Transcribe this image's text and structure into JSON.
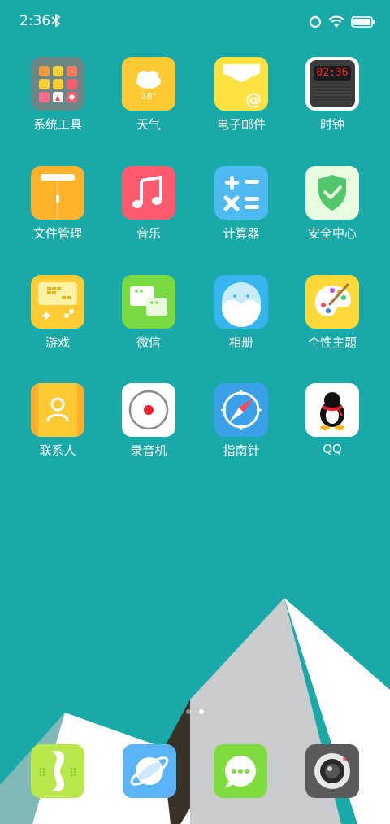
{
  "status": {
    "time": "2:36"
  },
  "apps": [
    {
      "label": "系统工具",
      "icon": "folder-icon"
    },
    {
      "label": "天气",
      "icon": "weather-icon",
      "temp": "28°"
    },
    {
      "label": "电子邮件",
      "icon": "email-icon",
      "glyph": "@"
    },
    {
      "label": "时钟",
      "icon": "clock-icon",
      "clock_text": "02:36"
    },
    {
      "label": "文件管理",
      "icon": "file-manager-icon"
    },
    {
      "label": "音乐",
      "icon": "music-icon"
    },
    {
      "label": "计算器",
      "icon": "calculator-icon"
    },
    {
      "label": "安全中心",
      "icon": "security-icon"
    },
    {
      "label": "游戏",
      "icon": "game-icon"
    },
    {
      "label": "微信",
      "icon": "wechat-icon"
    },
    {
      "label": "相册",
      "icon": "gallery-icon"
    },
    {
      "label": "个性主题",
      "icon": "theme-icon"
    },
    {
      "label": "联系人",
      "icon": "contacts-icon"
    },
    {
      "label": "录音机",
      "icon": "recorder-icon"
    },
    {
      "label": "指南针",
      "icon": "compass-icon"
    },
    {
      "label": "QQ",
      "icon": "qq-icon"
    }
  ],
  "dock": [
    {
      "icon": "phone-icon"
    },
    {
      "icon": "browser-icon"
    },
    {
      "icon": "messages-icon"
    },
    {
      "icon": "camera-icon"
    }
  ],
  "colors": {
    "background": "#1aa9a9",
    "accent_yellow": "#ffcf33",
    "accent_red": "#ff5a6e",
    "accent_green": "#79d941",
    "accent_blue": "#4fb9f2"
  }
}
